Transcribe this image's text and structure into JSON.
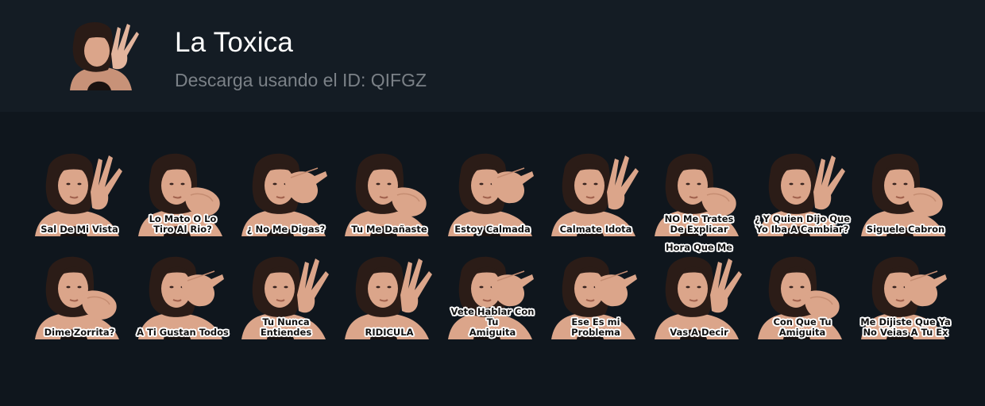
{
  "pack": {
    "title": "La Toxica",
    "download_text": "Descarga usando el ID: QIFGZ",
    "thumbnail_icon": "pack-thumbnail-icon"
  },
  "colors": {
    "page_bg": "#0f161d",
    "header_bg": "#141c24",
    "title": "#ffffff",
    "subtitle": "#7b8187"
  },
  "stickers": [
    {
      "caption": "Sal De Mi Vista",
      "pose": "hand-up"
    },
    {
      "caption": "Lo Mato O Lo\nTiro Al Rio?",
      "pose": "fist"
    },
    {
      "caption": "¿ No Me Digas?",
      "pose": "hand-face"
    },
    {
      "caption": "Tu Me Dañaste",
      "pose": "fist"
    },
    {
      "caption": "Estoy Calmada",
      "pose": "hand-face"
    },
    {
      "caption": "Calmate Idota",
      "pose": "hand-up"
    },
    {
      "caption": "NO Me  Trates\nDe Explicar",
      "pose": "fist"
    },
    {
      "caption": "¿ Y Quien Dijo Que\nYo Iba A Cambiar?",
      "pose": "hand-up"
    },
    {
      "caption": "Siguele Cabron",
      "pose": "fist"
    },
    {
      "caption": "Dime Zorrita?",
      "pose": "fist"
    },
    {
      "caption": "A Ti Gustan Todos",
      "pose": "hand-face"
    },
    {
      "caption": "Tu Nunca Entiendes",
      "pose": "hand-up"
    },
    {
      "caption": "RIDICULA",
      "pose": "hand-up"
    },
    {
      "caption": "Vete Hablar Con Tu\nAmiguita",
      "pose": "hand-face"
    },
    {
      "caption": "Ese Es mi\nProblema",
      "pose": "hand-face"
    },
    {
      "caption": "Hora Que Me",
      "caption_bottom": "Vas A Decir",
      "pose": "hand-up"
    },
    {
      "caption": "Con Que Tu\nAmiguita",
      "pose": "fist"
    },
    {
      "caption": "Me Dijiste Que Ya\nNo Veias A Tu Ex",
      "pose": "hand-face"
    }
  ]
}
